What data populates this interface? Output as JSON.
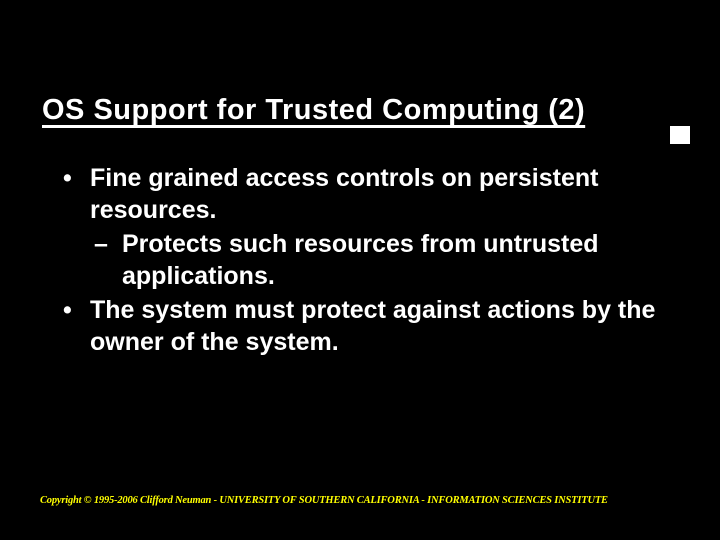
{
  "slide": {
    "title": "OS Support for Trusted Computing (2)",
    "bullets": {
      "b1a": "Fine grained access controls on persistent resources.",
      "b2a_dash": "–",
      "b2a": "Protects such resources from untrusted applications.",
      "b1b": "The system must protect against actions by the owner of the system."
    },
    "footer": "Copyright © 1995-2006 Clifford Neuman - UNIVERSITY OF SOUTHERN CALIFORNIA - INFORMATION SCIENCES INSTITUTE"
  }
}
